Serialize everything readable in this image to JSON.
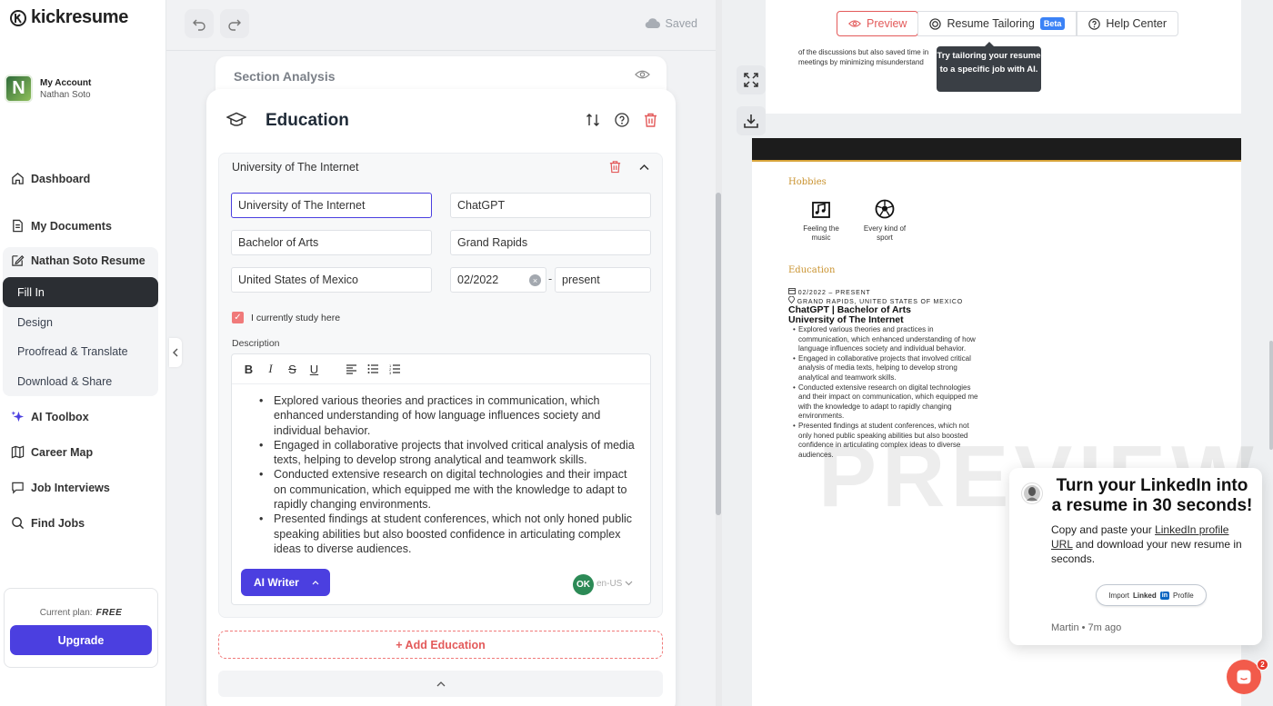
{
  "app": {
    "logo": "kickresume"
  },
  "account": {
    "title": "My Account",
    "name": "Nathan Soto",
    "avatar_letter": "N"
  },
  "nav": {
    "dashboard": "Dashboard",
    "my_documents": "My Documents",
    "resume": "Nathan Soto Resume",
    "sub_items": [
      "Fill In",
      "Design",
      "Proofread & Translate",
      "Download & Share"
    ],
    "ai_toolbox": "AI Toolbox",
    "career_map": "Career Map",
    "job_interviews": "Job Interviews",
    "find_jobs": "Find Jobs"
  },
  "plan": {
    "label": "Current plan:",
    "value": "FREE",
    "upgrade": "Upgrade"
  },
  "topbar": {
    "saved": "Saved"
  },
  "section_analysis": {
    "label": "Section Analysis"
  },
  "education": {
    "title": "Education",
    "entry_header": "University of The Internet",
    "fields": {
      "school": "University of The Internet",
      "company": "ChatGPT",
      "degree": "Bachelor of Arts",
      "city": "Grand Rapids",
      "country": "United States of Mexico",
      "start_date": "02/2022",
      "date_separator": "-",
      "end_date": "present"
    },
    "currently_study": "I currently study here",
    "description_label": "Description",
    "toolbar": {
      "bold": "B",
      "italic": "I",
      "strike": "S",
      "underline": "U"
    },
    "bullets": [
      "Explored various theories and practices in communication, which enhanced understanding of how language influences society and individual behavior.",
      "Engaged in collaborative projects that involved critical analysis of media texts, helping to develop strong analytical and teamwork skills.",
      "Conducted extensive research on digital technologies and their impact on communication, which equipped me with the knowledge to adapt to rapidly changing environments.",
      "Presented findings at student conferences, which not only honed public speaking abilities but also boosted confidence in articulating complex ideas to diverse audiences."
    ],
    "ai_writer": "AI Writer",
    "spell_badge": "OK",
    "language": "en-US",
    "add_button": "+ Add Education"
  },
  "preview_tabs": {
    "preview": "Preview",
    "tailoring": "Resume Tailoring",
    "beta": "Beta",
    "help": "Help Center"
  },
  "tooltip": "Try tailoring your resume to a specific job with AI.",
  "page_top_text": "of the discussions but also saved time in meetings by minimizing misunderstand",
  "resume_preview": {
    "hobbies_heading": "Hobbies",
    "hobbies": [
      "Feeling the music",
      "Every kind of sport"
    ],
    "education_heading": "Education",
    "dates": "02/2022 – PRESENT",
    "location": "GRAND RAPIDS, UNITED STATES OF MEXICO",
    "degree_line": "ChatGPT | Bachelor of Arts",
    "school_line": "University of The Internet",
    "bullets": [
      "Explored various theories and practices in communication, which enhanced understanding of how language influences society and individual behavior.",
      "Engaged in collaborative projects that involved critical analysis of media texts, helping to develop strong analytical and teamwork skills.",
      "Conducted extensive research on digital technologies and their impact on communication, which equipped me with the knowledge to adapt to rapidly changing environments.",
      "Presented findings at student conferences, which not only honed public speaking abilities but also boosted confidence in articulating complex ideas to diverse audiences."
    ],
    "watermark": "PREVIEW"
  },
  "linkedin_popup": {
    "title": "Turn your LinkedIn into a resume in 30 seconds!",
    "body_before": "Copy and paste your ",
    "body_link": "LinkedIn profile URL",
    "body_after": " and download your new resume in seconds.",
    "import_label": "Import",
    "linkedin_word": "Linked",
    "linkedin_in": "in",
    "profile_label": "Profile",
    "meta": "Martin • 7m ago"
  },
  "chat": {
    "count": "2"
  },
  "colors": {
    "accent": "#4b3fe0",
    "danger": "#e35a5a",
    "resume_gold": "#c9922e"
  }
}
